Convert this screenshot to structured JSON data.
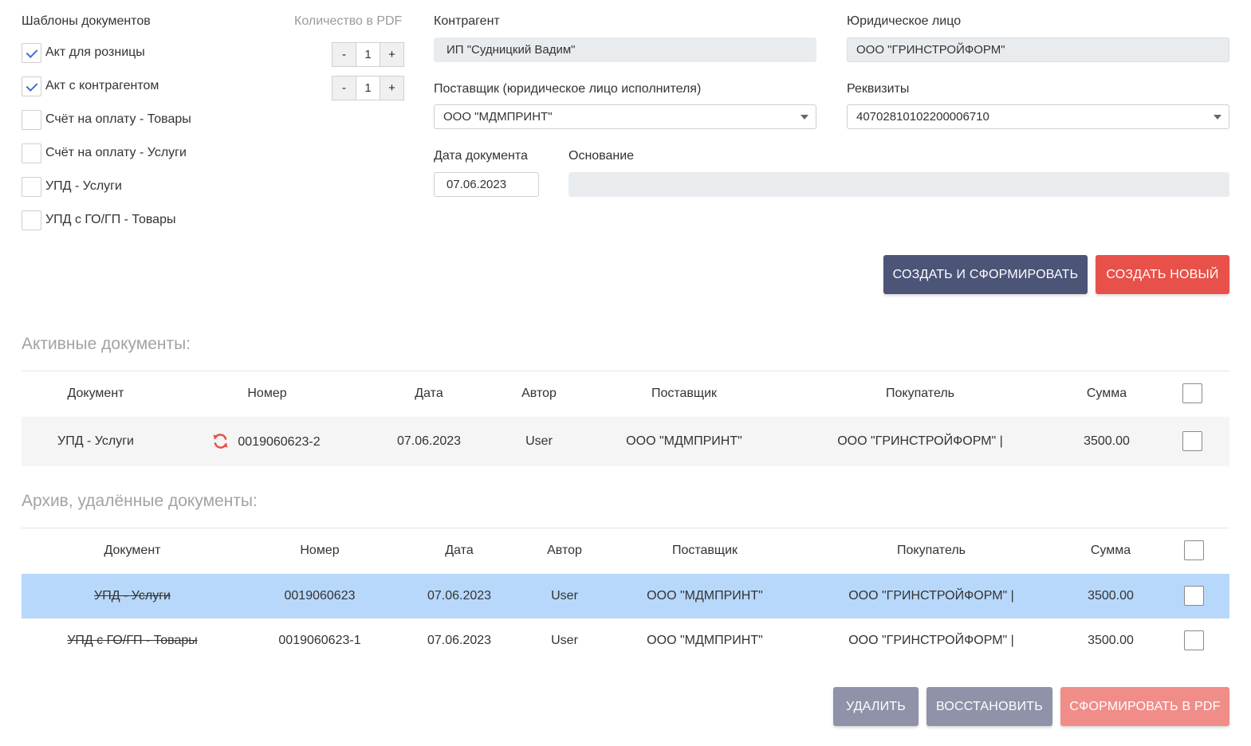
{
  "templates": {
    "title": "Шаблоны документов",
    "count_label": "Количество в PDF",
    "items": [
      {
        "label": "Акт для розницы",
        "checked": true,
        "count": "1"
      },
      {
        "label": "Акт с контрагентом",
        "checked": true,
        "count": "1"
      },
      {
        "label": "Счёт на оплату - Товары",
        "checked": false
      },
      {
        "label": "Счёт на оплату - Услуги",
        "checked": false
      },
      {
        "label": "УПД - Услуги",
        "checked": false
      },
      {
        "label": "УПД с ГО/ГП - Товары",
        "checked": false
      }
    ],
    "minus": "-",
    "plus": "+"
  },
  "form": {
    "counterparty_label": "Контрагент",
    "counterparty_value": "ИП \"Судницкий Вадим\"",
    "legal_entity_label": "Юридическое лицо",
    "legal_entity_value": "ООО \"ГРИНСТРОЙФОРМ\"",
    "supplier_label": "Поставщик (юридическое лицо исполнителя)",
    "supplier_value": "ООО \"МДМПРИНТ\"",
    "requisites_label": "Реквизиты",
    "requisites_value": "40702810102200006710",
    "date_label": "Дата документа",
    "date_value": "07.06.2023",
    "basis_label": "Основание",
    "basis_value": ""
  },
  "actions": {
    "create_and_form": "СОЗДАТЬ И СФОРМИРОВАТЬ",
    "create_new": "СОЗДАТЬ НОВЫЙ",
    "delete": "УДАЛИТЬ",
    "restore": "ВОССТАНОВИТЬ",
    "form_pdf": "СФОРМИРОВАТЬ В PDF"
  },
  "active": {
    "title": "Активные документы:",
    "headers": [
      "Документ",
      "Номер",
      "Дата",
      "Автор",
      "Поставщик",
      "Покупатель",
      "Сумма"
    ],
    "rows": [
      {
        "document": "УПД - Услуги",
        "number": "0019060623-2",
        "date": "07.06.2023",
        "author": "User",
        "supplier": "ООО \"МДМПРИНТ\"",
        "buyer": "ООО \"ГРИНСТРОЙФОРМ\" |",
        "sum": "3500.00"
      }
    ]
  },
  "archive": {
    "title": "Архив, удалённые документы:",
    "headers": [
      "Документ",
      "Номер",
      "Дата",
      "Автор",
      "Поставщик",
      "Покупатель",
      "Сумма"
    ],
    "rows": [
      {
        "document": "УПД - Услуги",
        "number": "0019060623",
        "date": "07.06.2023",
        "author": "User",
        "supplier": "ООО \"МДМПРИНТ\"",
        "buyer": "ООО \"ГРИНСТРОЙФОРМ\" |",
        "sum": "3500.00",
        "selected": true
      },
      {
        "document": "УПД с ГО/ГП - Товары",
        "number": "0019060623-1",
        "date": "07.06.2023",
        "author": "User",
        "supplier": "ООО \"МДМПРИНТ\"",
        "buyer": "ООО \"ГРИНСТРОЙФОРМ\" |",
        "sum": "3500.00",
        "selected": false
      }
    ]
  },
  "colors": {
    "primary_dark": "#4c5478",
    "danger": "#e85149",
    "selected_row": "#b8d8fb",
    "row_alt": "#f5f5f5"
  }
}
